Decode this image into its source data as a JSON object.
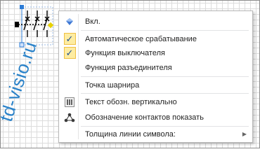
{
  "watermark": "td-visio.ru",
  "menu": {
    "items": [
      {
        "label": "Вкл.",
        "icon": "diamond-icon",
        "checked": false
      },
      {
        "label": "Автоматическое срабатывание",
        "icon": "check-icon",
        "checked": true
      },
      {
        "label": "Функция выключателя",
        "icon": "check-icon",
        "checked": true
      },
      {
        "label": "Функция разъединителя",
        "icon": "",
        "checked": false
      },
      {
        "label": "Точка шарнира",
        "icon": "",
        "checked": false
      },
      {
        "label": "Текст обозн. вертикально",
        "icon": "vertical-text-icon",
        "checked": false
      },
      {
        "label": "Обозначение контактов показать",
        "icon": "connection-icon",
        "checked": false
      },
      {
        "label": "Толщина линии символа:",
        "icon": "",
        "checked": false,
        "submenu": true
      }
    ]
  },
  "colors": {
    "check_bg": "#fdeca2",
    "check_border": "#f0c043",
    "watermark": "#2a82c9",
    "selection_handle": "#2b7bd6"
  }
}
